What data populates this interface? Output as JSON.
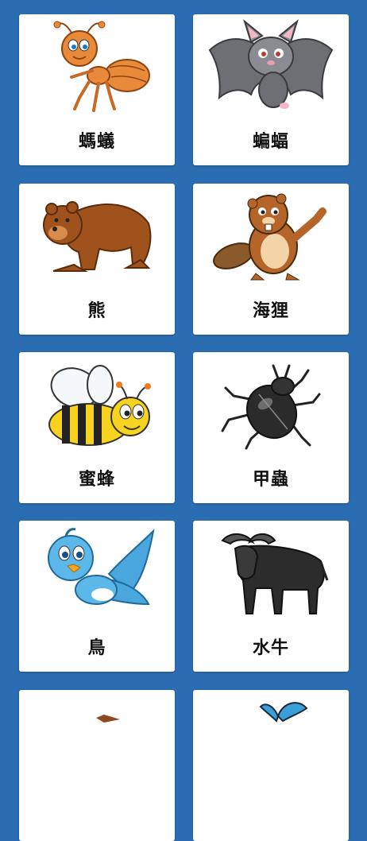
{
  "animals": [
    {
      "label": "螞蟻",
      "icon": "ant-icon"
    },
    {
      "label": "蝙蝠",
      "icon": "bat-icon"
    },
    {
      "label": "熊",
      "icon": "bear-icon"
    },
    {
      "label": "海狸",
      "icon": "beaver-icon"
    },
    {
      "label": "蜜蜂",
      "icon": "bee-icon"
    },
    {
      "label": "甲蟲",
      "icon": "beetle-icon"
    },
    {
      "label": "鳥",
      "icon": "bird-icon"
    },
    {
      "label": "水牛",
      "icon": "buffalo-icon"
    },
    {
      "label": "",
      "icon": "partial-animal-icon"
    },
    {
      "label": "",
      "icon": "butterfly-icon"
    }
  ],
  "colors": {
    "background": "#2a6db3",
    "card": "#ffffff"
  }
}
